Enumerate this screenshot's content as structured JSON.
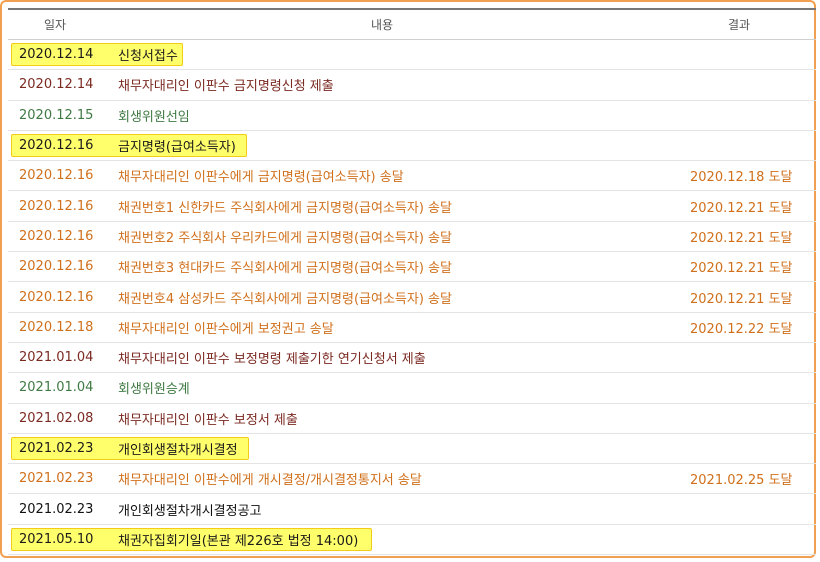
{
  "headers": {
    "date": "일자",
    "content": "내용",
    "result": "결과"
  },
  "rows": [
    {
      "date": "2020.12.14",
      "content": "신청서접수",
      "result": "",
      "style": "black",
      "highlight": "w1"
    },
    {
      "date": "2020.12.14",
      "content": "채무자대리인 이판수 금지명령신청 제출",
      "result": "",
      "style": "maroon",
      "highlight": ""
    },
    {
      "date": "2020.12.15",
      "content": "회생위원선임",
      "result": "",
      "style": "green",
      "highlight": ""
    },
    {
      "date": "2020.12.16",
      "content": "금지명령(급여소득자)",
      "result": "",
      "style": "black",
      "highlight": "w2"
    },
    {
      "date": "2020.12.16",
      "content": "채무자대리인 이판수에게 금지명령(급여소득자) 송달",
      "result": "2020.12.18 도달",
      "style": "orange",
      "highlight": ""
    },
    {
      "date": "2020.12.16",
      "content": "채권번호1 신한카드 주식회사에게 금지명령(급여소득자) 송달",
      "result": "2020.12.21 도달",
      "style": "orange",
      "highlight": ""
    },
    {
      "date": "2020.12.16",
      "content": "채권번호2 주식회사 우리카드에게 금지명령(급여소득자) 송달",
      "result": "2020.12.21 도달",
      "style": "orange",
      "highlight": ""
    },
    {
      "date": "2020.12.16",
      "content": "채권번호3 현대카드 주식회사에게 금지명령(급여소득자) 송달",
      "result": "2020.12.21 도달",
      "style": "orange",
      "highlight": ""
    },
    {
      "date": "2020.12.16",
      "content": "채권번호4 삼성카드 주식회사에게 금지명령(급여소득자) 송달",
      "result": "2020.12.21 도달",
      "style": "orange",
      "highlight": ""
    },
    {
      "date": "2020.12.18",
      "content": "채무자대리인 이판수에게 보정권고 송달",
      "result": "2020.12.22 도달",
      "style": "orange",
      "highlight": ""
    },
    {
      "date": "2021.01.04",
      "content": "채무자대리인 이판수 보정명령 제출기한 연기신청서 제출",
      "result": "",
      "style": "maroon",
      "highlight": ""
    },
    {
      "date": "2021.01.04",
      "content": "회생위원승계",
      "result": "",
      "style": "green",
      "highlight": ""
    },
    {
      "date": "2021.02.08",
      "content": "채무자대리인 이판수 보정서 제출",
      "result": "",
      "style": "maroon",
      "highlight": ""
    },
    {
      "date": "2021.02.23",
      "content": "개인회생절차개시결정",
      "result": "",
      "style": "black",
      "highlight": "w3"
    },
    {
      "date": "2021.02.23",
      "content": "채무자대리인 이판수에게 개시결정/개시결정통지서 송달",
      "result": "2021.02.25 도달",
      "style": "orange",
      "highlight": ""
    },
    {
      "date": "2021.02.23",
      "content": "개인회생절차개시결정공고",
      "result": "",
      "style": "black",
      "highlight": ""
    },
    {
      "date": "2021.05.10",
      "content": "채권자집회기일(본관 제226호 법정 14:00)",
      "result": "",
      "style": "black",
      "highlight": "w4"
    }
  ]
}
